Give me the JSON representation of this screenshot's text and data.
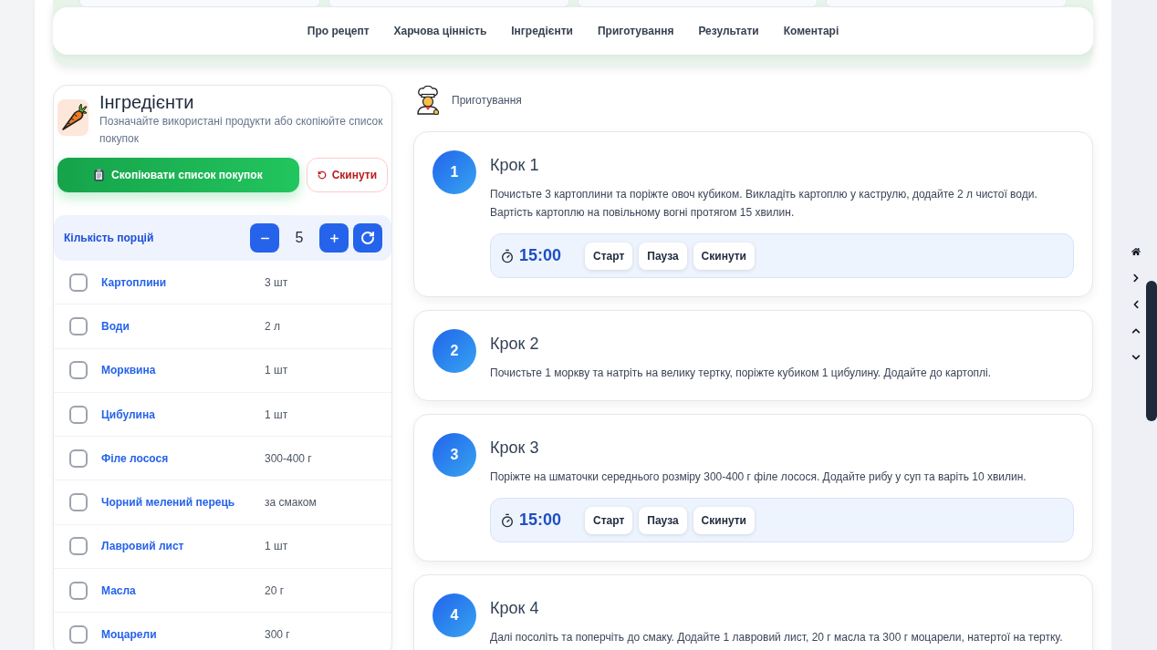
{
  "nav": {
    "links": [
      "Про рецепт",
      "Харчова цінність",
      "Інгредієнти",
      "Приготування",
      "Результати",
      "Коментарі"
    ]
  },
  "ingredients": {
    "title": "Інгредієнти",
    "subtitle": "Позначайте використані продукти або скопіюйте список покупок",
    "copy_button": "Скопіювати список покупок",
    "reset_button": "Скинути",
    "portions": {
      "label": "Кількість порцій",
      "value": "5"
    },
    "items": [
      {
        "name": "Картоплини",
        "amount": "3 шт",
        "checked": false
      },
      {
        "name": "Води",
        "amount": "2 л",
        "checked": false
      },
      {
        "name": "Морквина",
        "amount": "1 шт",
        "checked": false
      },
      {
        "name": "Цибулина",
        "amount": "1 шт",
        "checked": false
      },
      {
        "name": "Філе лосося",
        "amount": "300-400 г",
        "checked": false
      },
      {
        "name": "Чорний мелений перець",
        "amount": "за смаком",
        "checked": false
      },
      {
        "name": "Лавровий лист",
        "amount": "1 шт",
        "checked": false
      },
      {
        "name": "Масла",
        "amount": "20 г",
        "checked": false
      },
      {
        "name": "Моцарели",
        "amount": "300 г",
        "checked": false
      }
    ]
  },
  "cooking": {
    "title": "Приготування",
    "steps": [
      {
        "number": "1",
        "title": "Крок 1",
        "text": "Почистьте 3 картоплини та поріжте овоч кубиком. Викладіть картоплю у каструлю, додайте 2 л чистої води.\nВартість картоплю на повільному вогні протягом 15 хвилин.",
        "timer": {
          "time": "15:00",
          "buttons": [
            "Старт",
            "Пауза",
            "Скинути"
          ]
        }
      },
      {
        "number": "2",
        "title": "Крок 2",
        "text": "Почистьте 1 моркву та натріть на велику тертку, поріжте кубиком 1 цибулину. Додайте до картоплі."
      },
      {
        "number": "3",
        "title": "Крок 3",
        "text": "Поріжте на шматочки середнього розміру 300-400 г філе лосося. Додайте рибу у суп та варіть 10 хвилин.",
        "timer": {
          "time": "15:00",
          "buttons": [
            "Старт",
            "Пауза",
            "Скинути"
          ]
        }
      },
      {
        "number": "4",
        "title": "Крок 4",
        "text": "Далі посоліть та поперчіть до смаку. Додайте 1 лавровий лист, 20 г масла та 300 г моцарели, натертої на тертку."
      }
    ]
  }
}
